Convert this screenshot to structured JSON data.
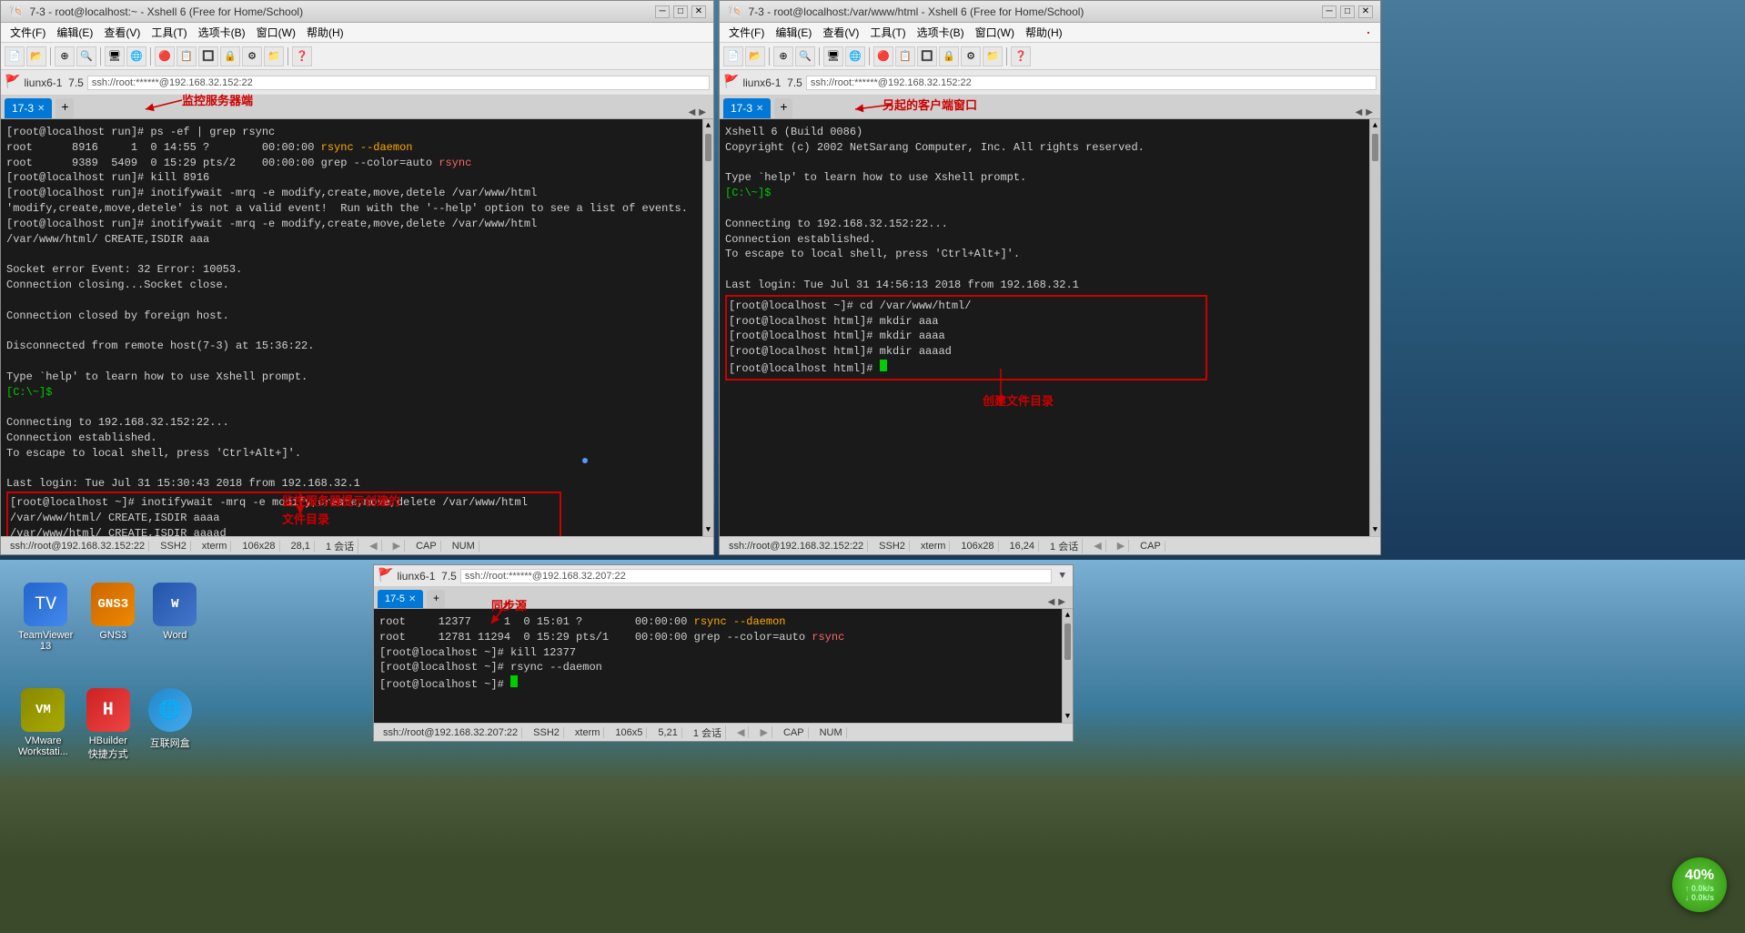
{
  "windows": {
    "left": {
      "title": "7-3 - root@localhost:~ - Xshell 6 (Free for Home/School)",
      "tab_label": "17-3",
      "session_name": "liunx6-1",
      "session_version": "7.5",
      "session_addr": "ssh://root:******@192.168.32.152:22",
      "menu_items": [
        "文件(F)",
        "编辑(E)",
        "查看(V)",
        "工具(T)",
        "选项卡(B)",
        "窗口(W)",
        "帮助(H)"
      ],
      "terminal_lines": [
        "[root@localhost run]# ps -ef | grep rsync",
        "root      8916     1  0 14:55 ?        00:00:00 rsync --daemon",
        "root      9389  5409  0 15:29 pts/2    00:00:00 grep --color=auto rsync",
        "[root@localhost run]# kill 8916",
        "[root@localhost run]# inotifywait -mrq -e modify,create,move,detele /var/www/html",
        "'modify,create,move,detele' is not a valid event!  Run with the '--help' option to see a list of events.",
        "[root@localhost run]# inotifywait -mrq -e modify,create,move,delete /var/www/html",
        "/var/www/html/ CREATE,ISDIR aaa",
        "",
        "Socket error Event: 32 Error: 10053.",
        "Connection closing...Socket close.",
        "",
        "Connection closed by foreign host.",
        "",
        "Disconnected from remote host(7-3) at 15:36:22.",
        "",
        "Type `help' to learn how to use Xshell prompt.",
        "[C:\\~]$",
        "",
        "Connecting to 192.168.32.152:22...",
        "Connection established.",
        "To escape to local shell, press 'Ctrl+Alt+]'.",
        "",
        "Last login: Tue Jul 31 15:30:43 2018 from 192.168.32.1",
        "[root@localhost ~]# inotifywait -mrq -e modify,create,move,delete /var/www/html",
        "/var/www/html/ CREATE,ISDIR aaaa",
        "/var/www/html/ CREATE,ISDIR aaaad"
      ],
      "statusbar": {
        "addr": "ssh://root@192.168.32.152:22",
        "protocol": "SSH2",
        "term": "xterm",
        "cols": "106x28",
        "pos": "28,1",
        "sessions": "1 会话",
        "cap": "CAP",
        "num": "NUM"
      }
    },
    "right": {
      "title": "7-3 - root@localhost:/var/www/html - Xshell 6 (Free for Home/School)",
      "tab_label": "17-3",
      "session_name": "liunx6-1",
      "session_version": "7.5",
      "session_addr": "ssh://root:******@192.168.32.152:22",
      "menu_items": [
        "文件(F)",
        "编辑(E)",
        "查看(V)",
        "工具(T)",
        "选项卡(B)",
        "窗口(W)",
        "帮助(H)"
      ],
      "terminal_lines": [
        "Xshell 6 (Build 0086)",
        "Copyright (c) 2002 NetSarang Computer, Inc. All rights reserved.",
        "",
        "Type `help' to learn how to use Xshell prompt.",
        "[C:\\~]$",
        "",
        "Connecting to 192.168.32.152:22...",
        "Connection established.",
        "To escape to local shell, press 'Ctrl+Alt+]'.",
        "",
        "Last login: Tue Jul 31 14:56:13 2018 from 192.168.32.1",
        "[root@localhost ~]# cd /var/www/html/",
        "[root@localhost html]# mkdir aaa",
        "[root@localhost html]# mkdir aaaa",
        "[root@localhost html]# mkdir aaaad",
        "[root@localhost html]# "
      ],
      "statusbar": {
        "addr": "ssh://root@192.168.32.152:22",
        "protocol": "SSH2",
        "term": "xterm",
        "cols": "106x28",
        "pos": "16,24",
        "sessions": "1 会话",
        "cap": "CAP"
      }
    },
    "bottom": {
      "title": "同步源",
      "tab_label": "17-5",
      "session_name": "liunx6-1",
      "session_version": "7.5",
      "session_addr": "ssh://root:******@192.168.32.207:22",
      "terminal_lines": [
        "root     12377     1  0 15:01 ?        00:00:00 rsync --daemon",
        "root     12781 11294  0 15:29 pts/1    00:00:00 grep --color=auto rsync",
        "[root@localhost ~]# kill 12377",
        "[root@localhost ~]# rsync --daemon",
        "[root@localhost ~]# "
      ],
      "statusbar": {
        "addr": "ssh://root@192.168.32.207:22",
        "protocol": "SSH2",
        "term": "xterm",
        "cols": "106x5",
        "pos": "5,21",
        "sessions": "1 会话",
        "cap": "CAP",
        "num": "NUM"
      }
    }
  },
  "annotations": {
    "monitor_server": "监控服务器端",
    "client_window": "另起的客户端窗口",
    "monitor_notify": "监控服务器提示创建的",
    "file_dir": "文件目录",
    "create_dir": "创建文件目录",
    "sync_source": "同步源"
  },
  "desktop_icons": [
    {
      "name": "TeamViewer",
      "label": "TeamViewer\n13",
      "color": "#2266cc"
    },
    {
      "name": "GNS3",
      "label": "GNS3",
      "color": "#cc6600"
    },
    {
      "name": "Word",
      "label": "Word",
      "color": "#2255aa"
    },
    {
      "name": "VMware",
      "label": "VMware\nWorkstati...",
      "color": "#888800"
    },
    {
      "name": "HBuilder",
      "label": "HBuilder\n快捷方式",
      "color": "#cc2222"
    },
    {
      "name": "互联网盒",
      "label": "互联网盒",
      "color": "#2288cc"
    }
  ],
  "circle_badge": {
    "percent": "40%",
    "up": "0.0k/s",
    "down": "0.0k/s"
  }
}
